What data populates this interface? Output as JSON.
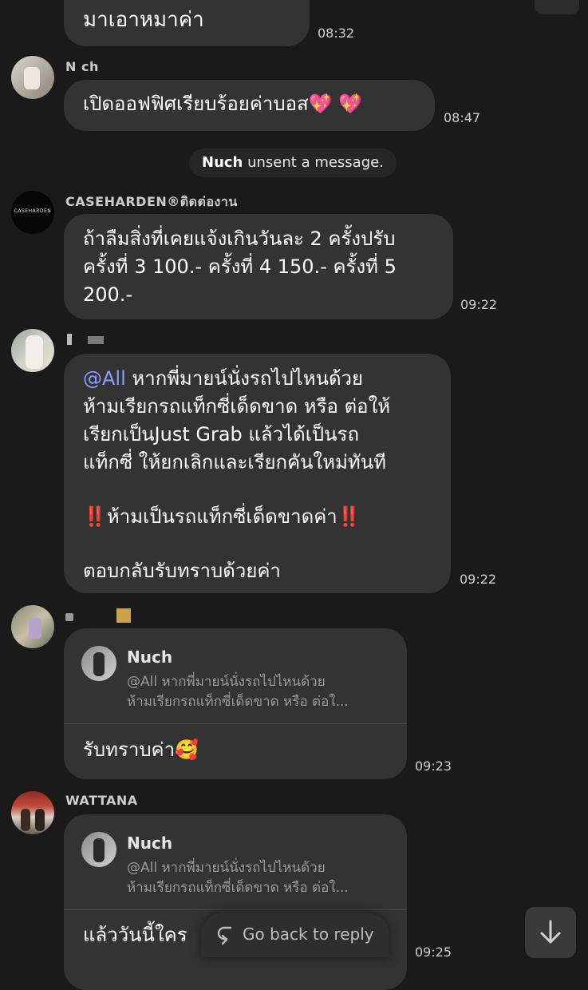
{
  "messages": [
    {
      "text": "มาเอาหมาค่า",
      "time": "08:32"
    },
    {
      "sender": "N  ch",
      "text": "เปิดออฟฟิศเรียบร้อยค่าบอส💖 💖",
      "time": "08:47"
    },
    {
      "system_name": "Nuch",
      "system_text": "unsent a message."
    },
    {
      "sender": "CASEHARDEN®ติดต่องาน",
      "avatar_text": "CASEHARDEN",
      "lines": [
        "ถ้าลืมสิ่งที่เคยแจ้งเกินวันละ 2 ครั้งปรับ",
        "ครั้งที่ 3 100.- ครั้งที่ 4 150.- ครั้งที่ 5",
        "200.-"
      ],
      "time": "09:22"
    },
    {
      "mention": "@All",
      "lines": [
        "หากพี่มายน์นั่งรถไปไหนด้วย",
        "ห้ามเรียกรถแท็กซี่เด็ดขาด หรือ ต่อให้",
        "เรียกเป็นJust Grab แล้วได้เป็นรถ",
        "แท็กซี่  ให้ยกเลิกและเรียกคันใหม่ทันที"
      ],
      "warning_emoji": "‼️",
      "warning_text": "ห้ามเป็นรถแท็กซี่เด็ดขาดค่า",
      "closing": "ตอบกลับรับทราบด้วยค่า",
      "time": "09:22"
    },
    {
      "quote_name": "Nuch",
      "quote_line1": "@All หากพี่มายน์นั่งรถไปไหนด้วย",
      "quote_line2": "ห้ามเรียกรถแท็กซี่เด็ดขาด หรือ ต่อใ...",
      "text": "รับทราบค่า🥰",
      "time": "09:23"
    },
    {
      "sender": "WATTANA",
      "quote_name": "Nuch",
      "quote_line1": "@All หากพี่มายน์นั่งรถไปไหนด้วย",
      "quote_line2": "ห้ามเรียกรถแท็กซี่เด็ดขาด หรือ ต่อใ...",
      "text": "แล้ววันนี้ใคร",
      "time": "09:25"
    }
  ],
  "go_back_label": "Go back to reply",
  "scroll_down_icon": "arrow-down-icon",
  "colors": {
    "background": "#1a1a1a",
    "bubble": "#333333",
    "mention": "#8e9dff",
    "time": "#cfcfcf"
  }
}
